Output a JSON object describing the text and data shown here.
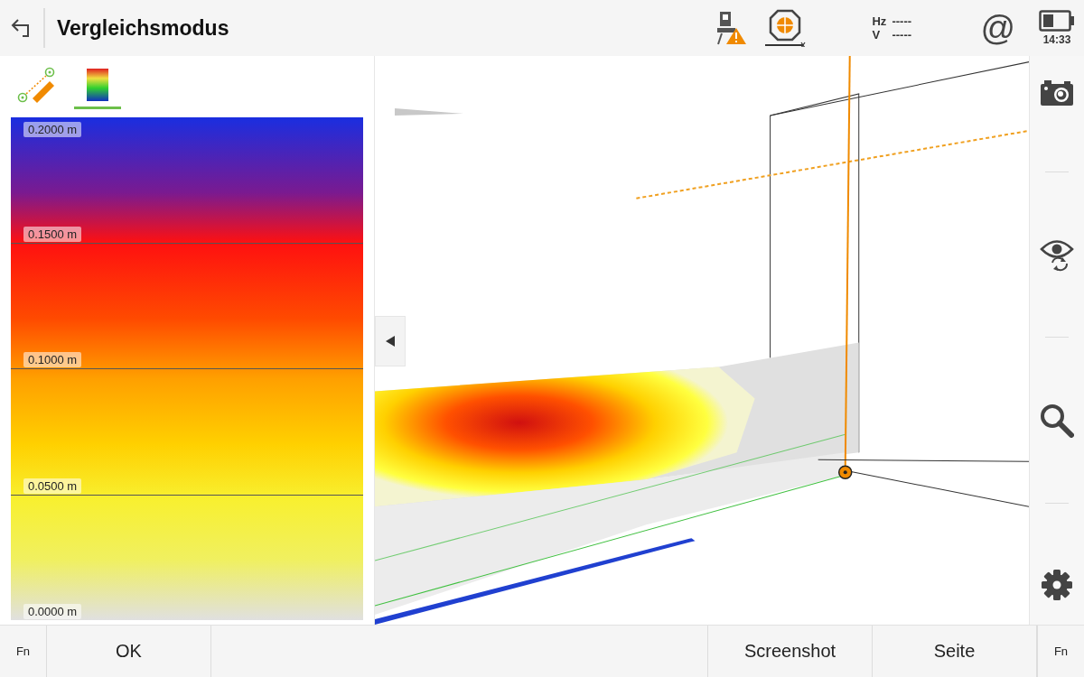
{
  "header": {
    "title": "Vergleichsmodus",
    "hz_label": "Hz",
    "hz_value": "-----",
    "v_label": "V",
    "v_value": "-----",
    "at_sign": "@",
    "time": "14:33"
  },
  "tabs": [
    {
      "kind": "measure",
      "selected": false
    },
    {
      "kind": "colorscale",
      "selected": true
    }
  ],
  "legend": {
    "labels": [
      "0.2000 m",
      "0.1500 m",
      "0.1000 m",
      "0.0500 m",
      "0.0000 m"
    ]
  },
  "toolbar": [
    {
      "kind": "camera"
    },
    {
      "kind": "view"
    },
    {
      "kind": "search"
    },
    {
      "kind": "settings"
    }
  ],
  "footer": [
    {
      "label": "Fn",
      "kind": "fn"
    },
    {
      "label": "OK",
      "kind": "wide"
    },
    {
      "kind": "spacer"
    },
    {
      "label": "Screenshot",
      "kind": "wide"
    },
    {
      "label": "Seite",
      "kind": "wide"
    },
    {
      "label": "Fn",
      "kind": "fn"
    }
  ]
}
